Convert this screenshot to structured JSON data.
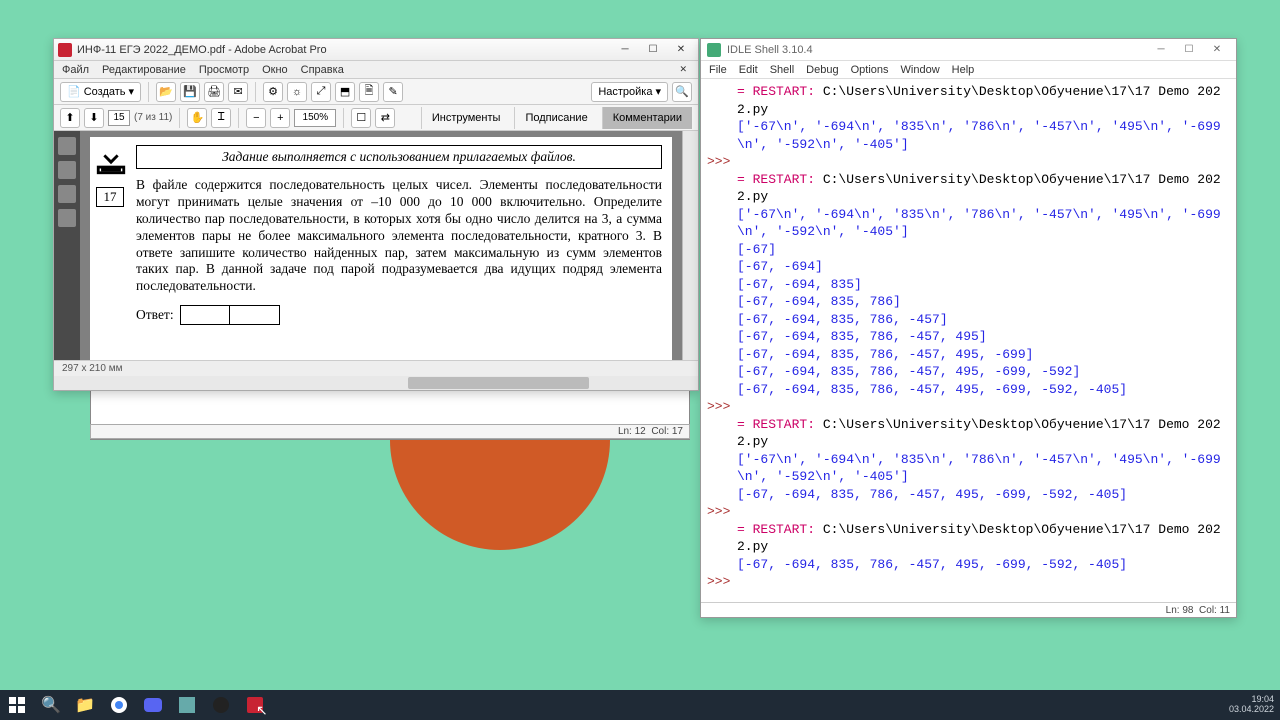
{
  "acrobat": {
    "title": "ИНФ-11 ЕГЭ 2022_ДЕМО.pdf - Adobe Acrobat Pro",
    "menu": [
      "Файл",
      "Редактирование",
      "Просмотр",
      "Окно",
      "Справка"
    ],
    "create": "Создать",
    "settings": "Настройка",
    "page": "15",
    "pagecount": "(7 из 11)",
    "zoom": "150%",
    "panels": {
      "tools": "Инструменты",
      "sign": "Подписание",
      "comments": "Комментарии"
    },
    "task_header": "Задание выполняется с использованием прилагаемых файлов.",
    "task_num": "17",
    "task_text": "В файле содержится последовательность целых чисел. Элементы последовательности могут принимать целые значения от –10 000 до 10 000 включительно. Определите количество пар последовательности, в которых хотя бы одно число делится на 3, а сумма элементов пары не более максимального элемента последовательности, кратного 3. В ответе запишите количество найденных пар, затем максимальную из сумм элементов таких пар. В данной задаче под парой подразумевается два идущих подряд элемента последовательности.",
    "answer_label": "Ответ:",
    "dims": "297 x 210 мм"
  },
  "white_status": {
    "ln": "Ln: 12",
    "col": "Col: 17"
  },
  "idle": {
    "title": "IDLE Shell 3.10.4",
    "menu": [
      "File",
      "Edit",
      "Shell",
      "Debug",
      "Options",
      "Window",
      "Help"
    ],
    "restart_label": "= RESTART:",
    "restart_path": "C:\\Users\\University\\Desktop\\Обучение\\17\\17 Demo 2022.py",
    "raw_list": "['-67\\n', '-694\\n', '835\\n', '786\\n', '-457\\n', '495\\n', '-699\\n', '-592\\n', '-405']",
    "seq": [
      "[-67]",
      "[-67, -694]",
      "[-67, -694, 835]",
      "[-67, -694, 835, 786]",
      "[-67, -694, 835, 786, -457]",
      "[-67, -694, 835, 786, -457, 495]",
      "[-67, -694, 835, 786, -457, 495, -699]",
      "[-67, -694, 835, 786, -457, 495, -699, -592]",
      "[-67, -694, 835, 786, -457, 495, -699, -592, -405]"
    ],
    "final": "[-67, -694, 835, 786, -457, 495, -699, -592, -405]",
    "prompt": ">>>",
    "status": {
      "ln": "Ln: 98",
      "col": "Col: 11"
    }
  },
  "tray": {
    "time": "19:04",
    "date": "03.04.2022"
  }
}
